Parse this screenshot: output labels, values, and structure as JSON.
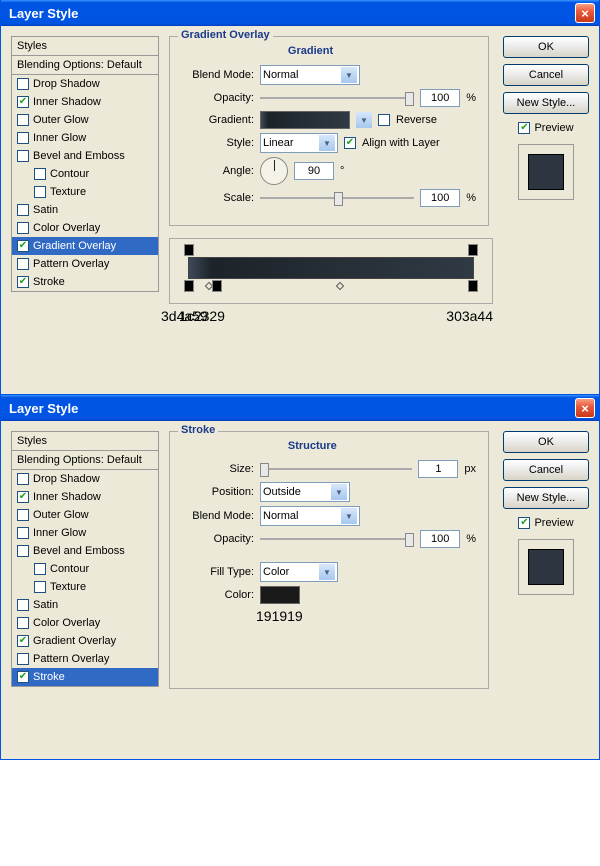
{
  "dlg1": {
    "title": "Layer Style",
    "close": "×",
    "styles_header": "Styles",
    "blending_header": "Blending Options: Default",
    "items": [
      {
        "label": "Drop Shadow",
        "checked": false,
        "active": false
      },
      {
        "label": "Inner Shadow",
        "checked": true,
        "active": false
      },
      {
        "label": "Outer Glow",
        "checked": false,
        "active": false
      },
      {
        "label": "Inner Glow",
        "checked": false,
        "active": false
      },
      {
        "label": "Bevel and Emboss",
        "checked": false,
        "active": false
      },
      {
        "label": "Contour",
        "checked": false,
        "active": false,
        "indent": true
      },
      {
        "label": "Texture",
        "checked": false,
        "active": false,
        "indent": true
      },
      {
        "label": "Satin",
        "checked": false,
        "active": false
      },
      {
        "label": "Color Overlay",
        "checked": false,
        "active": false
      },
      {
        "label": "Gradient Overlay",
        "checked": true,
        "active": true
      },
      {
        "label": "Pattern Overlay",
        "checked": false,
        "active": false
      },
      {
        "label": "Stroke",
        "checked": true,
        "active": false
      }
    ],
    "panel_title": "Gradient Overlay",
    "panel_sub": "Gradient",
    "blend_label": "Blend Mode:",
    "blend_value": "Normal",
    "opacity_label": "Opacity:",
    "opacity_value": "100",
    "pct": "%",
    "gradient_label": "Gradient:",
    "reverse_label": "Reverse",
    "style_label": "Style:",
    "style_value": "Linear",
    "align_label": "Align with Layer",
    "angle_label": "Angle:",
    "angle_value": "90",
    "deg": "°",
    "scale_label": "Scale:",
    "scale_value": "100",
    "hex1": "3d4a59",
    "hex2": "1c2329",
    "hex3": "303a44",
    "btn_ok": "OK",
    "btn_cancel": "Cancel",
    "btn_new": "New Style...",
    "preview_label": "Preview"
  },
  "dlg2": {
    "title": "Layer Style",
    "close": "×",
    "styles_header": "Styles",
    "blending_header": "Blending Options: Default",
    "items": [
      {
        "label": "Drop Shadow",
        "checked": false,
        "active": false
      },
      {
        "label": "Inner Shadow",
        "checked": true,
        "active": false
      },
      {
        "label": "Outer Glow",
        "checked": false,
        "active": false
      },
      {
        "label": "Inner Glow",
        "checked": false,
        "active": false
      },
      {
        "label": "Bevel and Emboss",
        "checked": false,
        "active": false
      },
      {
        "label": "Contour",
        "checked": false,
        "active": false,
        "indent": true
      },
      {
        "label": "Texture",
        "checked": false,
        "active": false,
        "indent": true
      },
      {
        "label": "Satin",
        "checked": false,
        "active": false
      },
      {
        "label": "Color Overlay",
        "checked": false,
        "active": false
      },
      {
        "label": "Gradient Overlay",
        "checked": true,
        "active": false
      },
      {
        "label": "Pattern Overlay",
        "checked": false,
        "active": false
      },
      {
        "label": "Stroke",
        "checked": true,
        "active": true
      }
    ],
    "panel_title": "Stroke",
    "panel_sub": "Structure",
    "size_label": "Size:",
    "size_value": "1",
    "px": "px",
    "position_label": "Position:",
    "position_value": "Outside",
    "blend_label": "Blend Mode:",
    "blend_value": "Normal",
    "opacity_label": "Opacity:",
    "opacity_value": "100",
    "pct": "%",
    "fill_label": "Fill Type:",
    "fill_value": "Color",
    "color_label": "Color:",
    "color_hex": "191919",
    "btn_ok": "OK",
    "btn_cancel": "Cancel",
    "btn_new": "New Style...",
    "preview_label": "Preview"
  }
}
